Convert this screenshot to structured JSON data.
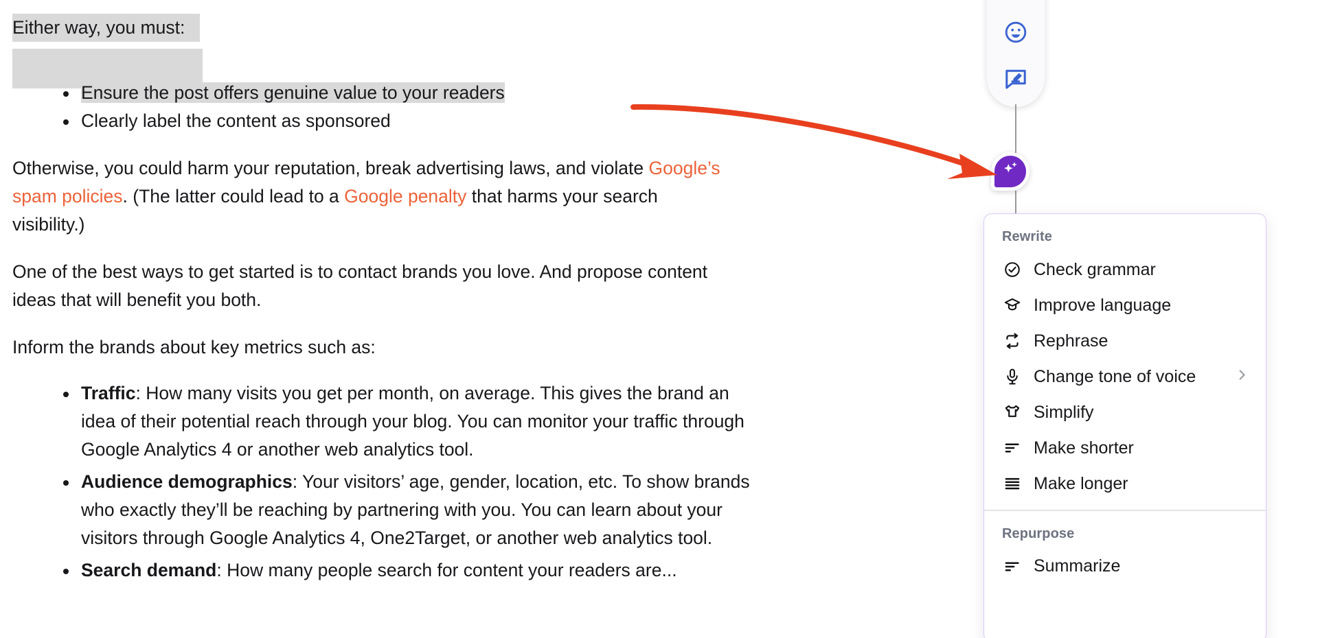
{
  "document": {
    "intro": {
      "text": "Either way, you must:",
      "selected": true
    },
    "intro_bullets": [
      {
        "text": "Ensure the post offers genuine value to your readers",
        "selected": true
      },
      {
        "text": "Clearly label the content as sponsored",
        "selected": false
      }
    ],
    "paragraph_warning": {
      "part1": "Otherwise, you could harm your reputation, break advertising laws, and violate ",
      "link1": "Google’s spam policies",
      "part2": ". (The latter could lead to a ",
      "link2": "Google penalty",
      "part3": " that harms your search visibility.)"
    },
    "paragraph_contact": "One of the best ways to get started is to contact brands you love. And propose content ideas that will benefit you both.",
    "paragraph_metrics_lead": "Inform the brands about key metrics such as:",
    "metric_bullets": [
      {
        "term": "Traffic",
        "body": ": How many visits you get per month, on average. This gives the brand an idea of their potential reach through your blog. You can monitor your traffic through Google Analytics 4 or another web analytics tool."
      },
      {
        "term": "Audience demographics",
        "body": ": Your visitors’ age, gender, location, etc. To show brands who exactly they’ll be reaching by partnering with you. You can learn about your visitors through Google Analytics 4, One2Target, or another web analytics tool."
      },
      {
        "term": "Search demand",
        "body": ": How many people search for content your readers are..."
      }
    ]
  },
  "link_color": "#ec6239",
  "selection_color": "#d9d9d9",
  "annotation": {
    "arrow_color": "#e8401f",
    "name": "red-curved-arrow"
  },
  "toolbar": {
    "accent_color": "#3a63d0",
    "buttons": [
      {
        "icon": "cursor-pointer-icon",
        "label": ""
      },
      {
        "icon": "emoji-smiley-icon",
        "label": ""
      },
      {
        "icon": "comment-edit-icon",
        "label": ""
      }
    ]
  },
  "ai_button": {
    "icon": "ai-sparkle-bubble-icon",
    "color": "#7129c4",
    "label": ""
  },
  "menu": {
    "sections": [
      {
        "label": "Rewrite",
        "items": [
          {
            "label": "Check grammar",
            "icon": "check-circle-icon",
            "submenu": false
          },
          {
            "label": "Improve language",
            "icon": "graduation-cap-icon",
            "submenu": false
          },
          {
            "label": "Rephrase",
            "icon": "rephrase-arrows-icon",
            "submenu": false
          },
          {
            "label": "Change tone of voice",
            "icon": "microphone-icon",
            "submenu": true
          },
          {
            "label": "Simplify",
            "icon": "tshirt-icon",
            "submenu": false
          },
          {
            "label": "Make shorter",
            "icon": "align-short-lines-icon",
            "submenu": false
          },
          {
            "label": "Make longer",
            "icon": "align-long-lines-icon",
            "submenu": false
          }
        ]
      },
      {
        "label": "Repurpose",
        "items": [
          {
            "label": "Summarize",
            "icon": "summarize-lines-icon",
            "submenu": false
          }
        ]
      }
    ]
  }
}
